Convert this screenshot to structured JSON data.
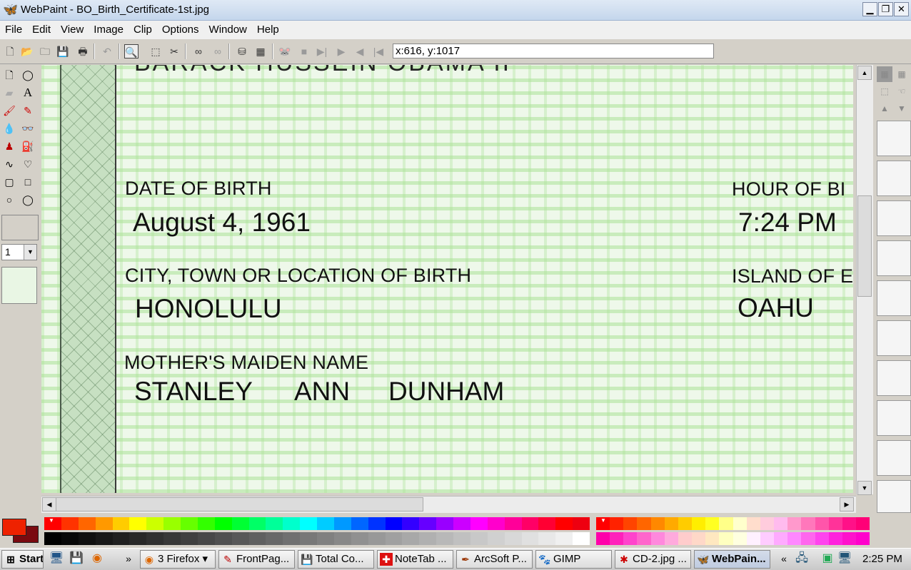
{
  "window": {
    "title": "WebPaint - BO_Birth_Certificate-1st.jpg",
    "app_icon": "butterfly-icon",
    "controls": [
      "minimize",
      "restore",
      "close"
    ]
  },
  "menubar": [
    "File",
    "Edit",
    "View",
    "Image",
    "Clip",
    "Options",
    "Window",
    "Help"
  ],
  "toolbar": {
    "coordinates": "x:616, y:1017",
    "icons": [
      "new-icon",
      "open-icon",
      "open-folder-icon",
      "save-icon",
      "print-icon",
      "undo-icon",
      "zoom-icon",
      "select-icon",
      "cut-icon",
      "copy-icon",
      "paste-icon",
      "stamp-icon",
      "checker-icon",
      "mickey-icon",
      "stop-icon",
      "next-frame-icon",
      "play-icon",
      "prev-icon",
      "first-icon"
    ]
  },
  "tools": {
    "brush_size": "1",
    "icons": [
      "page-icon",
      "lasso-icon",
      "eraser-icon",
      "text-icon",
      "brush-icon",
      "picker-icon",
      "drop-icon",
      "glasses-icon",
      "people-icon",
      "bucket-icon",
      "curve-icon",
      "heart-icon",
      "rounded-rect-icon",
      "rect-icon",
      "ellipse-icon",
      "circle-icon"
    ],
    "text_tool_glyph": "A"
  },
  "document": {
    "partial_top_text": "BARACK HUSSEIN OBAMA II",
    "fields": {
      "dob_label": "DATE OF BIRTH",
      "dob_value": "August 4, 1961",
      "hour_label": "HOUR OF BI",
      "hour_value": "7:24 PM",
      "city_label": "CITY, TOWN OR LOCATION OF BIRTH",
      "city_value": "HONOLULU",
      "island_label": "ISLAND OF E",
      "island_value": "OAHU",
      "mother_label": "MOTHER'S MAIDEN NAME",
      "mother_first": "STANLEY",
      "mother_middle": "ANN",
      "mother_last": "DUNHAM"
    }
  },
  "palette": {
    "foreground": "#ee2200",
    "background": "#7a0a10",
    "row1": [
      "#ff0000",
      "#ff3300",
      "#ff6600",
      "#ff9900",
      "#ffcc00",
      "#ffff00",
      "#ccff00",
      "#99ff00",
      "#66ff00",
      "#33ff00",
      "#00ff00",
      "#00ff33",
      "#00ff66",
      "#00ff99",
      "#00ffcc",
      "#00ffff",
      "#00ccff",
      "#0099ff",
      "#0066ff",
      "#0033ff",
      "#0000ff",
      "#3300ff",
      "#6600ff",
      "#9900ff",
      "#cc00ff",
      "#ff00ff",
      "#ff00cc",
      "#ff0099",
      "#ff0066",
      "#ff0033",
      "#ff0000",
      "#ee0010"
    ],
    "row2": [
      "#000000",
      "#080808",
      "#101010",
      "#181818",
      "#202020",
      "#282828",
      "#303030",
      "#383838",
      "#404040",
      "#484848",
      "#505050",
      "#585858",
      "#606060",
      "#686868",
      "#707070",
      "#787878",
      "#808080",
      "#888888",
      "#909090",
      "#989898",
      "#a0a0a0",
      "#a8a8a8",
      "#b0b0b0",
      "#b8b8b8",
      "#c0c0c0",
      "#c8c8c8",
      "#d0d0d0",
      "#d8d8d8",
      "#e0e0e0",
      "#e8e8e8",
      "#f0f0f0",
      "#ffffff"
    ],
    "row3": [
      "#ff0000",
      "#ff2200",
      "#ff4400",
      "#ff6600",
      "#ff8800",
      "#ffaa00",
      "#ffcc00",
      "#ffee00",
      "#ffff22",
      "#ffff88",
      "#ffffcc",
      "#ffddcc",
      "#ffccdd",
      "#ffbbee",
      "#ff99cc",
      "#ff77bb",
      "#ff55aa",
      "#ff3399",
      "#ff1188",
      "#ff0077"
    ],
    "row4": [
      "#ff00aa",
      "#ff22bb",
      "#ff44cc",
      "#ff66cc",
      "#ff88dd",
      "#ffaadd",
      "#ffcccc",
      "#ffd8c8",
      "#ffe8c0",
      "#ffffc0",
      "#ffffe0",
      "#fff0ff",
      "#ffccff",
      "#ffaaff",
      "#ff88ff",
      "#ff66ee",
      "#ff44ee",
      "#ff22dd",
      "#ff11cc",
      "#ff00cc"
    ]
  },
  "taskbar": {
    "start_label": "Start",
    "more_label": "»",
    "firefox_group": "3 Firefox",
    "items": [
      {
        "label": "FrontPag...",
        "icon": "frontpage-icon"
      },
      {
        "label": "Total Co...",
        "icon": "floppy-icon"
      },
      {
        "label": "NoteTab ...",
        "icon": "notetab-icon"
      },
      {
        "label": "ArcSoft P...",
        "icon": "arcsoft-icon"
      },
      {
        "label": "GIMP",
        "icon": "gimp-icon"
      },
      {
        "label": "CD-2.jpg ...",
        "icon": "paint-icon"
      },
      {
        "label": "WebPain...",
        "icon": "butterfly-icon"
      }
    ],
    "tray_more": "«",
    "clock": "2:25 PM"
  }
}
